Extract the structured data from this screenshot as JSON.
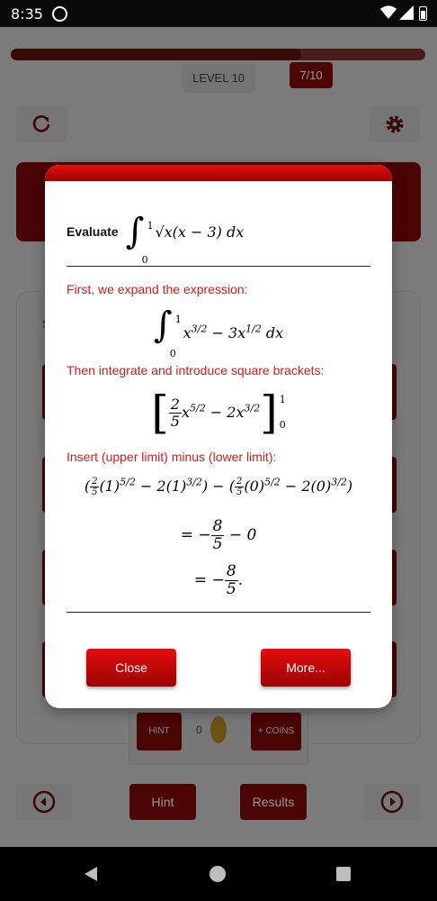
{
  "status_bar": {
    "time": "8:35"
  },
  "game": {
    "level_label": "LEVEL 10",
    "question_counter": "7/10",
    "progress_fraction": 0.7,
    "answers_panel_letter": "S",
    "hint_label": "HINT",
    "hint_count": "0",
    "coins_label": "+ COINS",
    "hint_button": "Hint",
    "results_button": "Results"
  },
  "dialog": {
    "evaluate_label": "Evaluate",
    "integral_upper": "1",
    "integral_lower": "0",
    "question_expr_pre": "√x",
    "question_expr_post": "(x − 3) dx",
    "step1_text": "First, we expand the expression:",
    "step1_expr_a": "x",
    "step1_exp_a": "3/2",
    "step1_expr_b": " − 3x",
    "step1_exp_b": "1/2",
    "step1_expr_c": " dx",
    "step2_text": "Then integrate and introduce square brackets:",
    "step2_num": "2",
    "step2_den": "5",
    "step2_x1": "x",
    "step2_exp1": "5/2",
    "step2_mid": " − 2x",
    "step2_exp2": "3/2",
    "bracket_upper": "1",
    "bracket_lower": "0",
    "step3_text": "Insert (upper limit) minus (lower limit):",
    "line1_a": "(1)",
    "line1_b": "0",
    "line2_prefix": "= −",
    "line2_num": "8",
    "line2_den": "5",
    "line2_suffix": " − 0",
    "line3_prefix": "= −",
    "line3_num": "8",
    "line3_den": "5",
    "line3_suffix": ".",
    "close_button": "Close",
    "more_button": "More..."
  },
  "colors": {
    "accent_red": "#d21b1b",
    "button_red": "#c40707",
    "divider_blue": "#1a1a8c"
  },
  "icons": [
    "app-status-icon",
    "wifi-icon",
    "signal-icon",
    "battery-icon",
    "refresh-icon",
    "settings-gear-icon",
    "prev-arrow-icon",
    "next-arrow-icon",
    "back-nav-icon",
    "home-nav-icon",
    "recents-nav-icon",
    "coin-icon"
  ]
}
